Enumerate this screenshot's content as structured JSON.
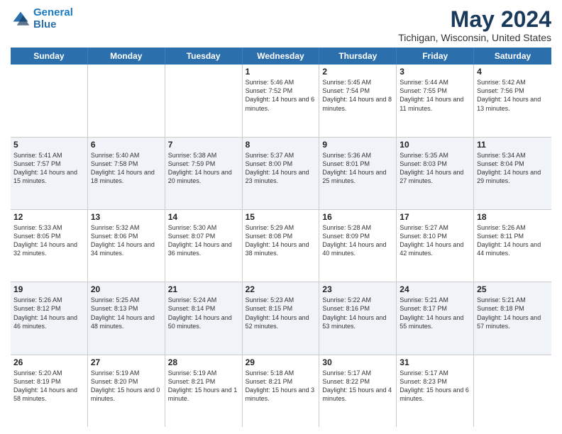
{
  "header": {
    "logo_line1": "General",
    "logo_line2": "Blue",
    "main_title": "May 2024",
    "subtitle": "Tichigan, Wisconsin, United States"
  },
  "days_of_week": [
    "Sunday",
    "Monday",
    "Tuesday",
    "Wednesday",
    "Thursday",
    "Friday",
    "Saturday"
  ],
  "weeks": [
    [
      {
        "day": "",
        "sunrise": "",
        "sunset": "",
        "daylight": ""
      },
      {
        "day": "",
        "sunrise": "",
        "sunset": "",
        "daylight": ""
      },
      {
        "day": "",
        "sunrise": "",
        "sunset": "",
        "daylight": ""
      },
      {
        "day": "1",
        "sunrise": "Sunrise: 5:46 AM",
        "sunset": "Sunset: 7:52 PM",
        "daylight": "Daylight: 14 hours and 6 minutes."
      },
      {
        "day": "2",
        "sunrise": "Sunrise: 5:45 AM",
        "sunset": "Sunset: 7:54 PM",
        "daylight": "Daylight: 14 hours and 8 minutes."
      },
      {
        "day": "3",
        "sunrise": "Sunrise: 5:44 AM",
        "sunset": "Sunset: 7:55 PM",
        "daylight": "Daylight: 14 hours and 11 minutes."
      },
      {
        "day": "4",
        "sunrise": "Sunrise: 5:42 AM",
        "sunset": "Sunset: 7:56 PM",
        "daylight": "Daylight: 14 hours and 13 minutes."
      }
    ],
    [
      {
        "day": "5",
        "sunrise": "Sunrise: 5:41 AM",
        "sunset": "Sunset: 7:57 PM",
        "daylight": "Daylight: 14 hours and 15 minutes."
      },
      {
        "day": "6",
        "sunrise": "Sunrise: 5:40 AM",
        "sunset": "Sunset: 7:58 PM",
        "daylight": "Daylight: 14 hours and 18 minutes."
      },
      {
        "day": "7",
        "sunrise": "Sunrise: 5:38 AM",
        "sunset": "Sunset: 7:59 PM",
        "daylight": "Daylight: 14 hours and 20 minutes."
      },
      {
        "day": "8",
        "sunrise": "Sunrise: 5:37 AM",
        "sunset": "Sunset: 8:00 PM",
        "daylight": "Daylight: 14 hours and 23 minutes."
      },
      {
        "day": "9",
        "sunrise": "Sunrise: 5:36 AM",
        "sunset": "Sunset: 8:01 PM",
        "daylight": "Daylight: 14 hours and 25 minutes."
      },
      {
        "day": "10",
        "sunrise": "Sunrise: 5:35 AM",
        "sunset": "Sunset: 8:03 PM",
        "daylight": "Daylight: 14 hours and 27 minutes."
      },
      {
        "day": "11",
        "sunrise": "Sunrise: 5:34 AM",
        "sunset": "Sunset: 8:04 PM",
        "daylight": "Daylight: 14 hours and 29 minutes."
      }
    ],
    [
      {
        "day": "12",
        "sunrise": "Sunrise: 5:33 AM",
        "sunset": "Sunset: 8:05 PM",
        "daylight": "Daylight: 14 hours and 32 minutes."
      },
      {
        "day": "13",
        "sunrise": "Sunrise: 5:32 AM",
        "sunset": "Sunset: 8:06 PM",
        "daylight": "Daylight: 14 hours and 34 minutes."
      },
      {
        "day": "14",
        "sunrise": "Sunrise: 5:30 AM",
        "sunset": "Sunset: 8:07 PM",
        "daylight": "Daylight: 14 hours and 36 minutes."
      },
      {
        "day": "15",
        "sunrise": "Sunrise: 5:29 AM",
        "sunset": "Sunset: 8:08 PM",
        "daylight": "Daylight: 14 hours and 38 minutes."
      },
      {
        "day": "16",
        "sunrise": "Sunrise: 5:28 AM",
        "sunset": "Sunset: 8:09 PM",
        "daylight": "Daylight: 14 hours and 40 minutes."
      },
      {
        "day": "17",
        "sunrise": "Sunrise: 5:27 AM",
        "sunset": "Sunset: 8:10 PM",
        "daylight": "Daylight: 14 hours and 42 minutes."
      },
      {
        "day": "18",
        "sunrise": "Sunrise: 5:26 AM",
        "sunset": "Sunset: 8:11 PM",
        "daylight": "Daylight: 14 hours and 44 minutes."
      }
    ],
    [
      {
        "day": "19",
        "sunrise": "Sunrise: 5:26 AM",
        "sunset": "Sunset: 8:12 PM",
        "daylight": "Daylight: 14 hours and 46 minutes."
      },
      {
        "day": "20",
        "sunrise": "Sunrise: 5:25 AM",
        "sunset": "Sunset: 8:13 PM",
        "daylight": "Daylight: 14 hours and 48 minutes."
      },
      {
        "day": "21",
        "sunrise": "Sunrise: 5:24 AM",
        "sunset": "Sunset: 8:14 PM",
        "daylight": "Daylight: 14 hours and 50 minutes."
      },
      {
        "day": "22",
        "sunrise": "Sunrise: 5:23 AM",
        "sunset": "Sunset: 8:15 PM",
        "daylight": "Daylight: 14 hours and 52 minutes."
      },
      {
        "day": "23",
        "sunrise": "Sunrise: 5:22 AM",
        "sunset": "Sunset: 8:16 PM",
        "daylight": "Daylight: 14 hours and 53 minutes."
      },
      {
        "day": "24",
        "sunrise": "Sunrise: 5:21 AM",
        "sunset": "Sunset: 8:17 PM",
        "daylight": "Daylight: 14 hours and 55 minutes."
      },
      {
        "day": "25",
        "sunrise": "Sunrise: 5:21 AM",
        "sunset": "Sunset: 8:18 PM",
        "daylight": "Daylight: 14 hours and 57 minutes."
      }
    ],
    [
      {
        "day": "26",
        "sunrise": "Sunrise: 5:20 AM",
        "sunset": "Sunset: 8:19 PM",
        "daylight": "Daylight: 14 hours and 58 minutes."
      },
      {
        "day": "27",
        "sunrise": "Sunrise: 5:19 AM",
        "sunset": "Sunset: 8:20 PM",
        "daylight": "Daylight: 15 hours and 0 minutes."
      },
      {
        "day": "28",
        "sunrise": "Sunrise: 5:19 AM",
        "sunset": "Sunset: 8:21 PM",
        "daylight": "Daylight: 15 hours and 1 minute."
      },
      {
        "day": "29",
        "sunrise": "Sunrise: 5:18 AM",
        "sunset": "Sunset: 8:21 PM",
        "daylight": "Daylight: 15 hours and 3 minutes."
      },
      {
        "day": "30",
        "sunrise": "Sunrise: 5:17 AM",
        "sunset": "Sunset: 8:22 PM",
        "daylight": "Daylight: 15 hours and 4 minutes."
      },
      {
        "day": "31",
        "sunrise": "Sunrise: 5:17 AM",
        "sunset": "Sunset: 8:23 PM",
        "daylight": "Daylight: 15 hours and 6 minutes."
      },
      {
        "day": "",
        "sunrise": "",
        "sunset": "",
        "daylight": ""
      }
    ]
  ]
}
